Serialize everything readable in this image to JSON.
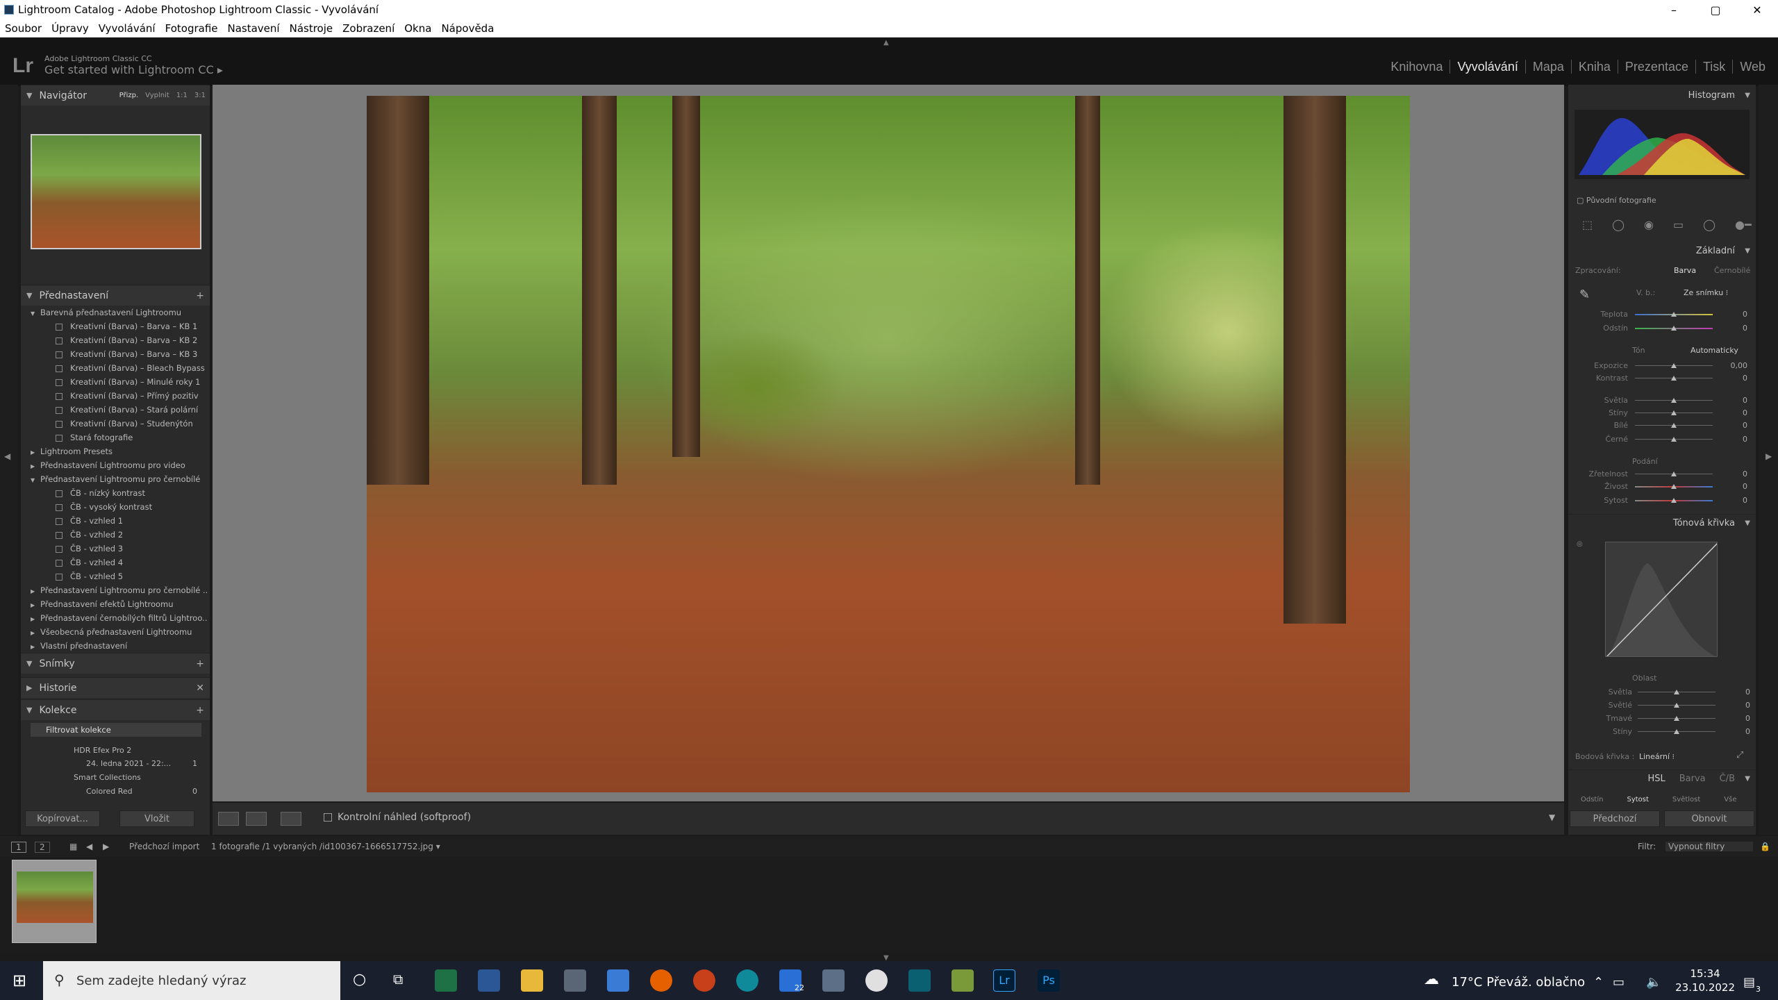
{
  "window": {
    "title": "Lightroom Catalog - Adobe Photoshop Lightroom Classic - Vyvolávání",
    "controls": [
      "–",
      "▢",
      "✕"
    ]
  },
  "menu": [
    "Soubor",
    "Úpravy",
    "Vyvolávání",
    "Fotografie",
    "Nastavení",
    "Nástroje",
    "Zobrazení",
    "Okna",
    "Nápověda"
  ],
  "identity": {
    "logo": "Lr",
    "small": "Adobe Lightroom Classic CC",
    "big": "Get started with Lightroom CC ▸"
  },
  "modules": {
    "items": [
      "Knihovna",
      "Vyvolávání",
      "Mapa",
      "Kniha",
      "Prezentace",
      "Tisk",
      "Web"
    ],
    "active": "Vyvolávání"
  },
  "left": {
    "navigator": {
      "title": "Navigátor",
      "opts": [
        "Přizp.",
        "Vyplnit",
        "1:1",
        "3:1"
      ]
    },
    "presets_title": "Přednastavení",
    "presets": [
      {
        "label": "Barevná přednastavení Lightroomu",
        "level": 1,
        "open": true
      },
      {
        "label": "Kreativní (Barva) – Barva – KB 1",
        "level": 2
      },
      {
        "label": "Kreativní (Barva) – Barva – KB 2",
        "level": 2
      },
      {
        "label": "Kreativní (Barva) – Barva – KB 3",
        "level": 2
      },
      {
        "label": "Kreativní (Barva) – Bleach Bypass ef...",
        "level": 2
      },
      {
        "label": "Kreativní (Barva) – Minulé roky 1",
        "level": 2
      },
      {
        "label": "Kreativní (Barva) – Přímý pozitiv",
        "level": 2
      },
      {
        "label": "Kreativní (Barva) – Stará polární",
        "level": 2
      },
      {
        "label": "Kreativní (Barva) – Studenýtón",
        "level": 2
      },
      {
        "label": "Stará fotografie",
        "level": 2
      },
      {
        "label": "Lightroom Presets",
        "level": 1,
        "open": false
      },
      {
        "label": "Přednastavení Lightroomu pro video",
        "level": 1,
        "open": false
      },
      {
        "label": "Přednastavení Lightroomu pro černobílé",
        "level": 1,
        "open": true
      },
      {
        "label": "ČB - nízký kontrast",
        "level": 2
      },
      {
        "label": "ČB - vysoký kontrast",
        "level": 2
      },
      {
        "label": "ČB - vzhled 1",
        "level": 2
      },
      {
        "label": "ČB - vzhled 2",
        "level": 2
      },
      {
        "label": "ČB - vzhled 3",
        "level": 2
      },
      {
        "label": "ČB - vzhled 4",
        "level": 2
      },
      {
        "label": "ČB - vzhled 5",
        "level": 2
      },
      {
        "label": "Přednastavení Lightroomu pro černobílé ...",
        "level": 1,
        "open": false
      },
      {
        "label": "Přednastavení efektů Lightroomu",
        "level": 1,
        "open": false
      },
      {
        "label": "Přednastavení černobílých filtrů Lightroo...",
        "level": 1,
        "open": false
      },
      {
        "label": "Všeobecná přednastavení Lightroomu",
        "level": 1,
        "open": false
      },
      {
        "label": "Vlastní přednastavení",
        "level": 1,
        "open": false
      }
    ],
    "snapshots": "Snímky",
    "history": "Historie",
    "collections": "Kolekce",
    "filter": "Filtrovat kolekce",
    "coll_items": [
      {
        "label": "HDR Efex Pro 2",
        "count": ""
      },
      {
        "label": "24. ledna 2021 - 22:...",
        "count": "1"
      },
      {
        "label": "Smart Collections",
        "count": ""
      },
      {
        "label": "Colored Red",
        "count": "0"
      }
    ],
    "copy_btn": "Kopírovat...",
    "paste_btn": "Vložit"
  },
  "center": {
    "softproof": "Kontrolní náhled (softproof)"
  },
  "right": {
    "histogram": "Histogram",
    "original": "Původní fotografie",
    "basic": "Základní",
    "treatment_label": "Zpracování:",
    "treatment_color": "Barva",
    "treatment_bw": "Černobílé",
    "wb_label": "V. b.:",
    "wb_value": "Ze snímku ⁝",
    "temp": "Teplota",
    "tint": "Odstín",
    "tone": "Tón",
    "auto": "Automaticky",
    "exposure": "Expozice",
    "exposure_val": "0,00",
    "contrast": "Kontrast",
    "highlights": "Světla",
    "shadows": "Stíny",
    "whites": "Bílé",
    "blacks": "Černé",
    "presence": "Podání",
    "clarity": "Zřetelnost",
    "vibrance": "Živost",
    "saturation": "Sytost",
    "zero": "0",
    "tonecurve": "Tónová křivka",
    "region": "Oblast",
    "r_highlights": "Světla",
    "r_lights": "Světlé",
    "r_darks": "Tmavé",
    "r_shadows": "Stíny",
    "pointcurve_label": "Bodová křivka :",
    "pointcurve_value": "Lineární ⁝",
    "hsl": "HSL",
    "hsl_color": "Barva",
    "hsl_bw": "Č/B",
    "hsl_tabs": [
      "Odstín",
      "Sytost",
      "Světlost",
      "Vše"
    ],
    "prev_btn": "Předchozí",
    "reset_btn": "Obnovit"
  },
  "filmbar": {
    "pages": [
      "1",
      "2"
    ],
    "source": "Předchozí import",
    "info": "1 fotografie /1 vybraných /id100367-1666517752.jpg ▾",
    "filter_label": "Filtr:",
    "filter_value": "Vypnout filtry"
  },
  "taskbar": {
    "search": "Sem zadejte hledaný výraz",
    "weather": "17°C  Převáž. oblačno",
    "time": "15:34",
    "date": "23.10.2022",
    "mail_badge": "22",
    "notif": "3"
  }
}
